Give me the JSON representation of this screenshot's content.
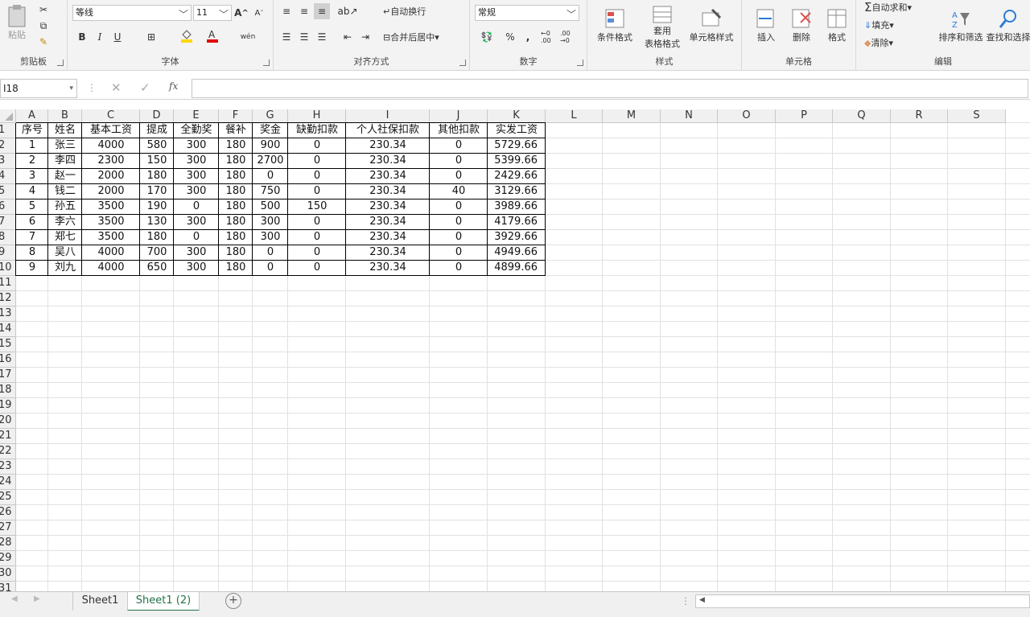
{
  "ribbon": {
    "clipboard": {
      "paste": "粘贴",
      "label": "剪贴板"
    },
    "font": {
      "name": "等线",
      "size": "11",
      "bold": "B",
      "italic": "I",
      "underline": "U",
      "grow": "A",
      "shrink": "A",
      "label": "字体"
    },
    "align": {
      "wrap": "自动换行",
      "merge": "合并后居中",
      "label": "对齐方式"
    },
    "number": {
      "format": "常规",
      "percent": "%",
      "comma": ",",
      "inc": "←0 .00",
      "dec": ".00 →0",
      "label": "数字"
    },
    "styles": {
      "cond": "条件格式",
      "table_l1": "套用",
      "table_l2": "表格格式",
      "cell": "单元格样式",
      "label": "样式"
    },
    "cells": {
      "insert": "插入",
      "delete": "删除",
      "format": "格式",
      "label": "单元格"
    },
    "editing": {
      "autosum": "自动求和",
      "fill": "填充",
      "clear": "清除",
      "sort": "排序和筛选",
      "find": "查找和选择",
      "label": "编辑"
    }
  },
  "formula_bar": {
    "name_box": "I18",
    "fx": "fx",
    "value": ""
  },
  "columns": [
    "A",
    "B",
    "C",
    "D",
    "E",
    "F",
    "G",
    "H",
    "I",
    "J",
    "K",
    "L",
    "M",
    "N",
    "O",
    "P",
    "Q",
    "R",
    "S"
  ],
  "table": {
    "headers": [
      "序号",
      "姓名",
      "基本工资",
      "提成",
      "全勤奖",
      "餐补",
      "奖金",
      "缺勤扣款",
      "个人社保扣款",
      "其他扣款",
      "实发工资"
    ],
    "rows": [
      [
        "1",
        "张三",
        "4000",
        "580",
        "300",
        "180",
        "900",
        "0",
        "230.34",
        "0",
        "5729.66"
      ],
      [
        "2",
        "李四",
        "2300",
        "150",
        "300",
        "180",
        "2700",
        "0",
        "230.34",
        "0",
        "5399.66"
      ],
      [
        "3",
        "赵一",
        "2000",
        "180",
        "300",
        "180",
        "0",
        "0",
        "230.34",
        "0",
        "2429.66"
      ],
      [
        "4",
        "钱二",
        "2000",
        "170",
        "300",
        "180",
        "750",
        "0",
        "230.34",
        "40",
        "3129.66"
      ],
      [
        "5",
        "孙五",
        "3500",
        "190",
        "0",
        "180",
        "500",
        "150",
        "230.34",
        "0",
        "3989.66"
      ],
      [
        "6",
        "李六",
        "3500",
        "130",
        "300",
        "180",
        "300",
        "0",
        "230.34",
        "0",
        "4179.66"
      ],
      [
        "7",
        "郑七",
        "3500",
        "180",
        "0",
        "180",
        "300",
        "0",
        "230.34",
        "0",
        "3929.66"
      ],
      [
        "8",
        "吴八",
        "4000",
        "700",
        "300",
        "180",
        "0",
        "0",
        "230.34",
        "0",
        "4949.66"
      ],
      [
        "9",
        "刘九",
        "4000",
        "650",
        "300",
        "180",
        "0",
        "0",
        "230.34",
        "0",
        "4899.66"
      ]
    ]
  },
  "row_numbers": [
    "1",
    "2",
    "3",
    "4",
    "5",
    "6",
    "7",
    "8",
    "9",
    "10",
    "11",
    "12",
    "13",
    "14",
    "15",
    "16",
    "17",
    "18",
    "19",
    "20",
    "21",
    "22",
    "23",
    "24",
    "25",
    "26",
    "27",
    "28",
    "29",
    "30",
    "31"
  ],
  "sheets": [
    {
      "name": "Sheet1",
      "active": false
    },
    {
      "name": "Sheet1 (2)",
      "active": true
    }
  ],
  "colors": {
    "accent": "#217346",
    "border": "#000000",
    "font_color": "#e00000",
    "fill_color": "#ffd800"
  }
}
